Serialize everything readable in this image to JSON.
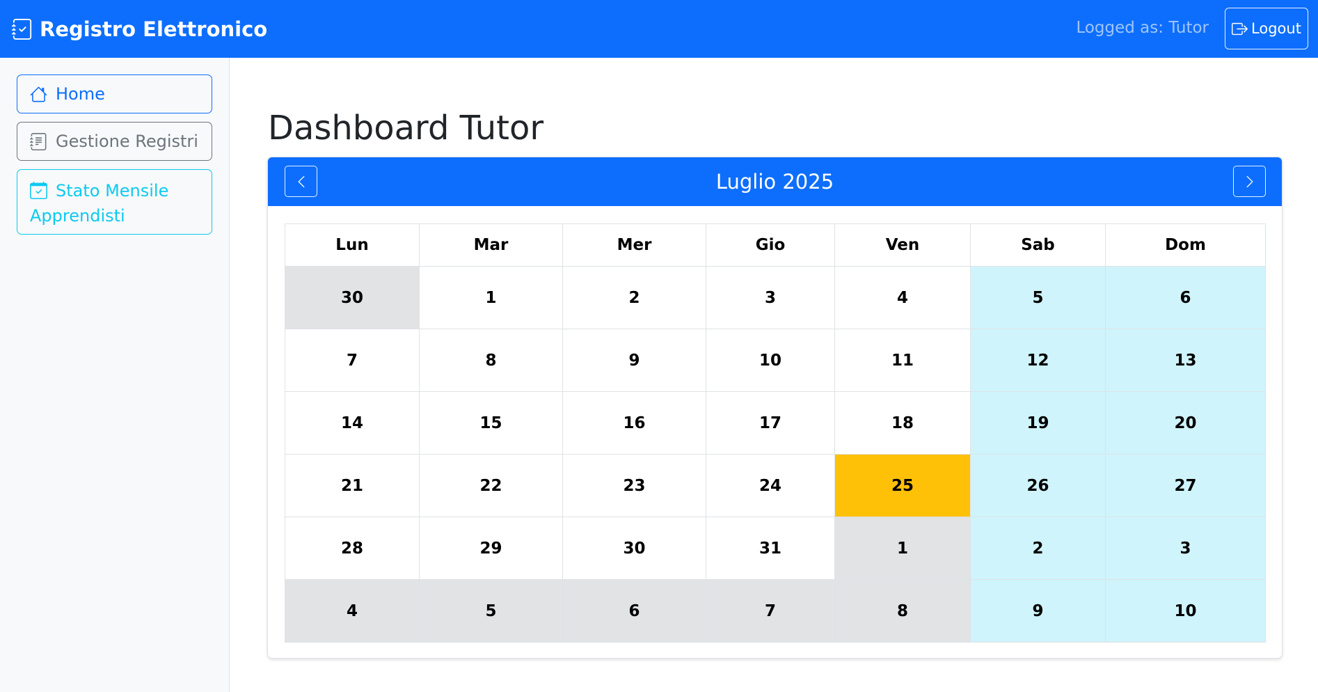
{
  "navbar": {
    "brand": "Registro Elettronico",
    "logged_as": "Logged as: Tutor",
    "logout_label": "Logout"
  },
  "sidebar": {
    "items": [
      {
        "label": "Home",
        "icon": "house-icon"
      },
      {
        "label": "Gestione Registri",
        "icon": "journal-icon"
      },
      {
        "label": "Stato Mensile Apprendisti",
        "icon": "calendar-check-icon"
      }
    ]
  },
  "main": {
    "title": "Dashboard Tutor"
  },
  "calendar": {
    "month_label": "Luglio 2025",
    "weekdays": [
      "Lun",
      "Mar",
      "Mer",
      "Gio",
      "Ven",
      "Sab",
      "Dom"
    ],
    "weeks": [
      [
        {
          "d": "30",
          "k": "other"
        },
        {
          "d": "1",
          "k": ""
        },
        {
          "d": "2",
          "k": ""
        },
        {
          "d": "3",
          "k": ""
        },
        {
          "d": "4",
          "k": ""
        },
        {
          "d": "5",
          "k": "weekend"
        },
        {
          "d": "6",
          "k": "weekend"
        }
      ],
      [
        {
          "d": "7",
          "k": ""
        },
        {
          "d": "8",
          "k": ""
        },
        {
          "d": "9",
          "k": ""
        },
        {
          "d": "10",
          "k": ""
        },
        {
          "d": "11",
          "k": ""
        },
        {
          "d": "12",
          "k": "weekend"
        },
        {
          "d": "13",
          "k": "weekend"
        }
      ],
      [
        {
          "d": "14",
          "k": ""
        },
        {
          "d": "15",
          "k": ""
        },
        {
          "d": "16",
          "k": ""
        },
        {
          "d": "17",
          "k": ""
        },
        {
          "d": "18",
          "k": ""
        },
        {
          "d": "19",
          "k": "weekend"
        },
        {
          "d": "20",
          "k": "weekend"
        }
      ],
      [
        {
          "d": "21",
          "k": ""
        },
        {
          "d": "22",
          "k": ""
        },
        {
          "d": "23",
          "k": ""
        },
        {
          "d": "24",
          "k": ""
        },
        {
          "d": "25",
          "k": "today"
        },
        {
          "d": "26",
          "k": "weekend"
        },
        {
          "d": "27",
          "k": "weekend"
        }
      ],
      [
        {
          "d": "28",
          "k": ""
        },
        {
          "d": "29",
          "k": ""
        },
        {
          "d": "30",
          "k": ""
        },
        {
          "d": "31",
          "k": ""
        },
        {
          "d": "1",
          "k": "other"
        },
        {
          "d": "2",
          "k": "weekend"
        },
        {
          "d": "3",
          "k": "weekend"
        }
      ],
      [
        {
          "d": "4",
          "k": "other"
        },
        {
          "d": "5",
          "k": "other"
        },
        {
          "d": "6",
          "k": "other"
        },
        {
          "d": "7",
          "k": "other"
        },
        {
          "d": "8",
          "k": "other"
        },
        {
          "d": "9",
          "k": "weekend"
        },
        {
          "d": "10",
          "k": "weekend"
        }
      ]
    ]
  },
  "colors": {
    "primary": "#0d6efd",
    "secondary": "#6c757d",
    "info": "#0dcaf0",
    "today": "#ffc107",
    "weekend_bg": "#cff4fc",
    "other_month_bg": "#e2e3e5"
  }
}
